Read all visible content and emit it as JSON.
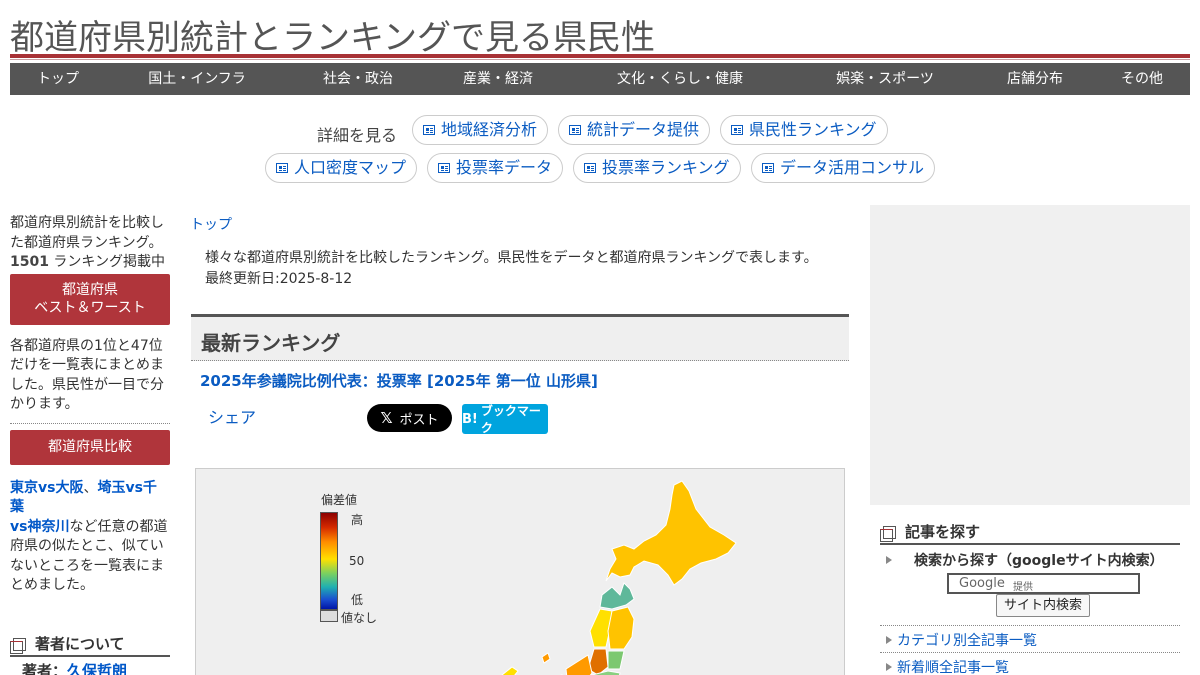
{
  "site": {
    "title": "都道府県別統計とランキングで見る県民性"
  },
  "nav": {
    "items": [
      "トップ",
      "国土・インフラ",
      "社会・政治",
      "産業・経済",
      "文化・くらし・健康",
      "娯楽・スポーツ",
      "店舗分布",
      "その他"
    ]
  },
  "detail": {
    "label": "詳細を見る",
    "links": [
      "地域経済分析",
      "統計データ提供",
      "県民性ランキング",
      "人口密度マップ",
      "投票率データ",
      "投票率ランキング",
      "データ活用コンサル"
    ]
  },
  "left": {
    "intro_text": "都道府県別統計を比較した都道府県ランキング。",
    "count": "1501",
    "count_suffix": " ランキング掲載中",
    "best_worst_button": [
      "都道府県",
      "ベスト＆ワースト"
    ],
    "best_worst_text": "各都道府県の1位と47位だけを一覧表にまとめました。県民性が一目で分かります。",
    "compare_button": "都道府県比較",
    "compare_link1": "東京vs大阪",
    "compare_sep": "、",
    "compare_link2": "埼玉vs千葉",
    "compare_link3": "vs神奈川",
    "compare_text": "など任意の都道府県の似たとこ、似ていないところを一覧表にまとめました。",
    "author_heading": "著者について",
    "author_label": "著者：",
    "author_name": "久保哲朗"
  },
  "main": {
    "breadcrumb": "トップ",
    "intro_line1": "様々な都道府県別統計を比較したランキング。県民性をデータと都道府県ランキングで表します。",
    "intro_line2": "最終更新日:2025-8-12",
    "latest_heading": "最新ランキング",
    "latest_link": "2025年参議院比例代表：投票率 [2025年 第一位 山形県]",
    "share_label": "シェア",
    "x_post_label": "ポスト",
    "hatena_label": "ブックマーク",
    "legend": {
      "title": "偏差値",
      "high": "高",
      "mid": "50",
      "low": "低",
      "none": "値なし"
    }
  },
  "right": {
    "search_heading": "記事を探す",
    "search_sub": "検索から探す（googleサイト内検索）",
    "search_brand": "Google",
    "search_brand_suffix": "提供",
    "search_button": "サイト内検索",
    "links": [
      "カテゴリ別全記事一覧",
      "新着順全記事一覧"
    ]
  },
  "colors": {
    "accent": "#a83236",
    "nav_bg": "#555555",
    "link": "#0b5cc2",
    "map_orange": "#ffc300"
  }
}
